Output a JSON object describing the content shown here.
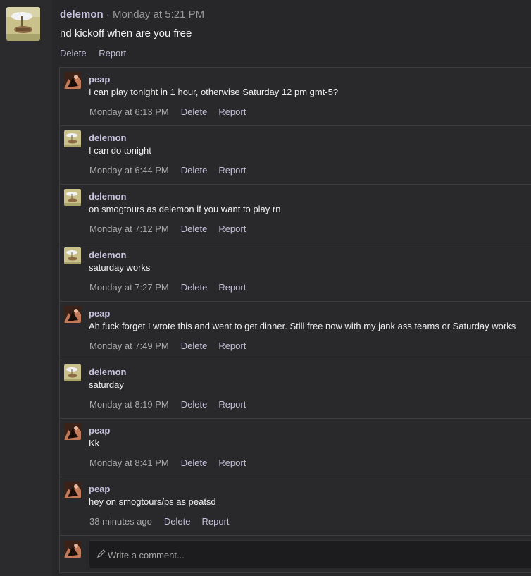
{
  "post": {
    "author": "delemon",
    "separator": "·",
    "time": "Monday at 5:21 PM",
    "text": "nd kickoff when are you free",
    "actions": [
      "Delete",
      "Report"
    ]
  },
  "comments": [
    {
      "author": "peap",
      "avatar": "peap-avatar",
      "text": "I can play tonight in 1 hour, otherwise Saturday 12 pm gmt-5?",
      "time": "Monday at 6:13 PM",
      "actions": [
        "Delete",
        "Report"
      ]
    },
    {
      "author": "delemon",
      "avatar": "delemon-avatar",
      "text": "I can do tonight",
      "time": "Monday at 6:44 PM",
      "actions": [
        "Delete",
        "Report"
      ]
    },
    {
      "author": "delemon",
      "avatar": "delemon-avatar",
      "text": "on smogtours as delemon if you want to play rn",
      "time": "Monday at 7:12 PM",
      "actions": [
        "Delete",
        "Report"
      ]
    },
    {
      "author": "delemon",
      "avatar": "delemon-avatar",
      "text": "saturday works",
      "time": "Monday at 7:27 PM",
      "actions": [
        "Delete",
        "Report"
      ]
    },
    {
      "author": "peap",
      "avatar": "peap-avatar",
      "text": "Ah fuck forget I wrote this and went to get dinner. Still free now with my jank ass teams or Saturday works",
      "time": "Monday at 7:49 PM",
      "actions": [
        "Delete",
        "Report"
      ]
    },
    {
      "author": "delemon",
      "avatar": "delemon-avatar",
      "text": "saturday",
      "time": "Monday at 8:19 PM",
      "actions": [
        "Delete",
        "Report"
      ]
    },
    {
      "author": "peap",
      "avatar": "peap-avatar",
      "text": "Kk",
      "time": "Monday at 8:41 PM",
      "actions": [
        "Delete",
        "Report"
      ]
    },
    {
      "author": "peap",
      "avatar": "peap-avatar",
      "text": "hey on smogtours/ps as peatsd",
      "time": "38 minutes ago",
      "actions": [
        "Delete",
        "Report"
      ]
    }
  ],
  "compose": {
    "placeholder": "Write a comment...",
    "icon": "pencil-icon"
  },
  "colors": {
    "author": "#c7c3de",
    "link": "#c2c0d6",
    "background": "#27272a"
  }
}
